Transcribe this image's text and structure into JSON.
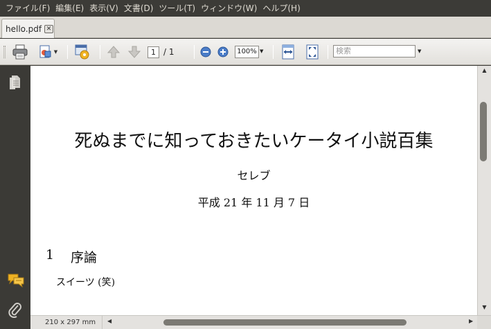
{
  "menubar": {
    "items": [
      {
        "label": "ファイル",
        "key": "F"
      },
      {
        "label": "編集",
        "key": "E"
      },
      {
        "label": "表示",
        "key": "V"
      },
      {
        "label": "文書",
        "key": "D"
      },
      {
        "label": "ツール",
        "key": "T"
      },
      {
        "label": "ウィンドウ",
        "key": "W"
      },
      {
        "label": "ヘルプ",
        "key": "H"
      }
    ],
    "labels": [
      "ファイル(F)",
      "編集(E)",
      "表示(V)",
      "文書(D)",
      "ツール(T)",
      "ウィンドウ(W)",
      "ヘルプ(H)"
    ]
  },
  "tab": {
    "label": "hello.pdf",
    "close_glyph": "✕"
  },
  "toolbar": {
    "current_page": "1",
    "page_total": "/ 1",
    "zoom": "100%",
    "search_placeholder": "検索",
    "icons": [
      "print-icon",
      "export-icon",
      "web-icon",
      "prev-page-icon",
      "next-page-icon",
      "zoom-out-icon",
      "zoom-in-icon",
      "fit-width-icon",
      "fit-page-icon"
    ]
  },
  "sidebar": {
    "icons": [
      "pages-icon",
      "comments-icon",
      "attachments-icon"
    ]
  },
  "document": {
    "title": "死ぬまでに知っておきたいケータイ小説百集",
    "author": "セレブ",
    "date": "平成 21 年 11 月 7 日",
    "section_number": "1",
    "section_title": "序論",
    "body": "スイーツ (笑)"
  },
  "status": {
    "page_size": "210 x 297 mm"
  },
  "colors": {
    "menubar_bg": "#3c3b37",
    "sidebar_bg": "#3b3a36",
    "scroll_thumb": "#7c7a74"
  }
}
